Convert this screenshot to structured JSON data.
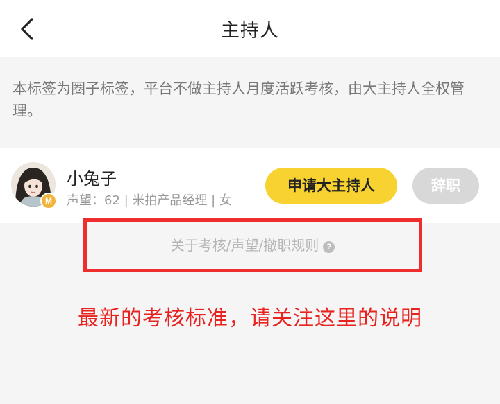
{
  "nav": {
    "title": "主持人",
    "back_icon": "chevron-left-icon"
  },
  "notice": {
    "text": "本标签为圈子标签，平台不做主持人月度活跃考核，由大主持人全权管理。"
  },
  "host": {
    "name": "小兔子",
    "meta": "声望：62 | 米拍产品经理 | 女",
    "badge": "M",
    "apply_label": "申请大主持人",
    "resign_label": "辞职"
  },
  "rules": {
    "link_text": "关于考核/声望/撤职规则",
    "help_icon": "?"
  },
  "annotation": {
    "text": "最新的考核标准，请关注这里的说明"
  },
  "colors": {
    "accent_yellow": "#f7d230",
    "annotation_red": "#ee2d2d",
    "disabled_gray": "#d8d8d8"
  }
}
